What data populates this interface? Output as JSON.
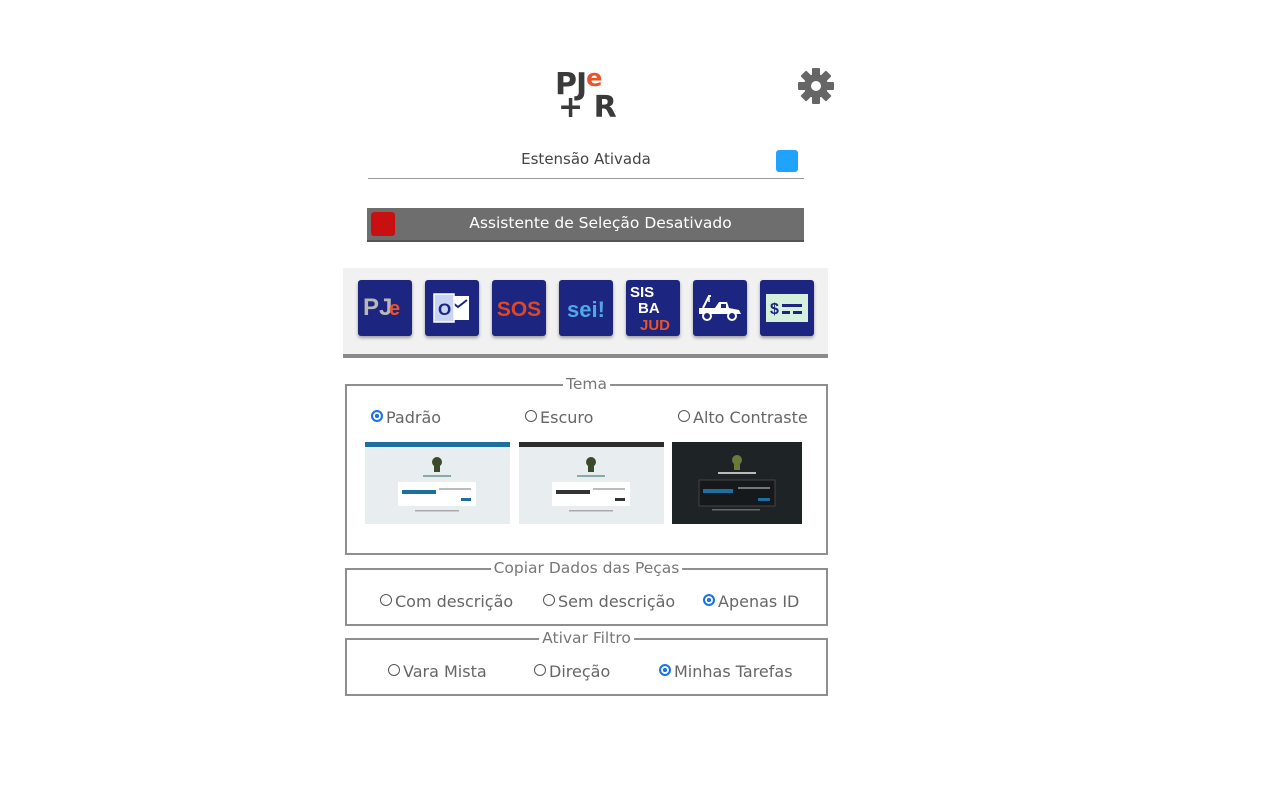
{
  "header": {
    "logo_top": "PJe",
    "logo_bottom": "+ R",
    "settings_icon": "gear-icon"
  },
  "extension": {
    "label": "Estensão Ativada",
    "checked": true,
    "color": "#1fa3ff"
  },
  "assistant": {
    "label": "Assistente de Seleção Desativado",
    "checked": false,
    "color": "#c81010"
  },
  "apps": [
    {
      "name": "pje",
      "icon": "pje-icon"
    },
    {
      "name": "outlook",
      "icon": "outlook-icon",
      "glyph": "O"
    },
    {
      "name": "sos",
      "icon": "sos-icon",
      "glyph": "SOS"
    },
    {
      "name": "sei",
      "icon": "sei-icon",
      "glyph": "sei!"
    },
    {
      "name": "sisbajud",
      "icon": "sisbajud-icon",
      "lines": [
        "SIS",
        "BA",
        "JUD"
      ]
    },
    {
      "name": "renajud",
      "icon": "tow-truck-icon"
    },
    {
      "name": "serasajud",
      "icon": "payment-slip-icon",
      "glyph": "$"
    }
  ],
  "theme": {
    "legend": "Tema",
    "options": [
      {
        "label": "Padrão",
        "selected": true
      },
      {
        "label": "Escuro",
        "selected": false
      },
      {
        "label": "Alto Contraste",
        "selected": false
      }
    ]
  },
  "copy_data": {
    "legend": "Copiar Dados das Peças",
    "options": [
      {
        "label": "Com descrição",
        "selected": false
      },
      {
        "label": "Sem descrição",
        "selected": false
      },
      {
        "label": "Apenas ID",
        "selected": true
      }
    ]
  },
  "filter": {
    "legend": "Ativar Filtro",
    "options": [
      {
        "label": "Vara Mista",
        "selected": false
      },
      {
        "label": "Direção",
        "selected": false
      },
      {
        "label": "Minhas Tarefas",
        "selected": true
      }
    ]
  }
}
